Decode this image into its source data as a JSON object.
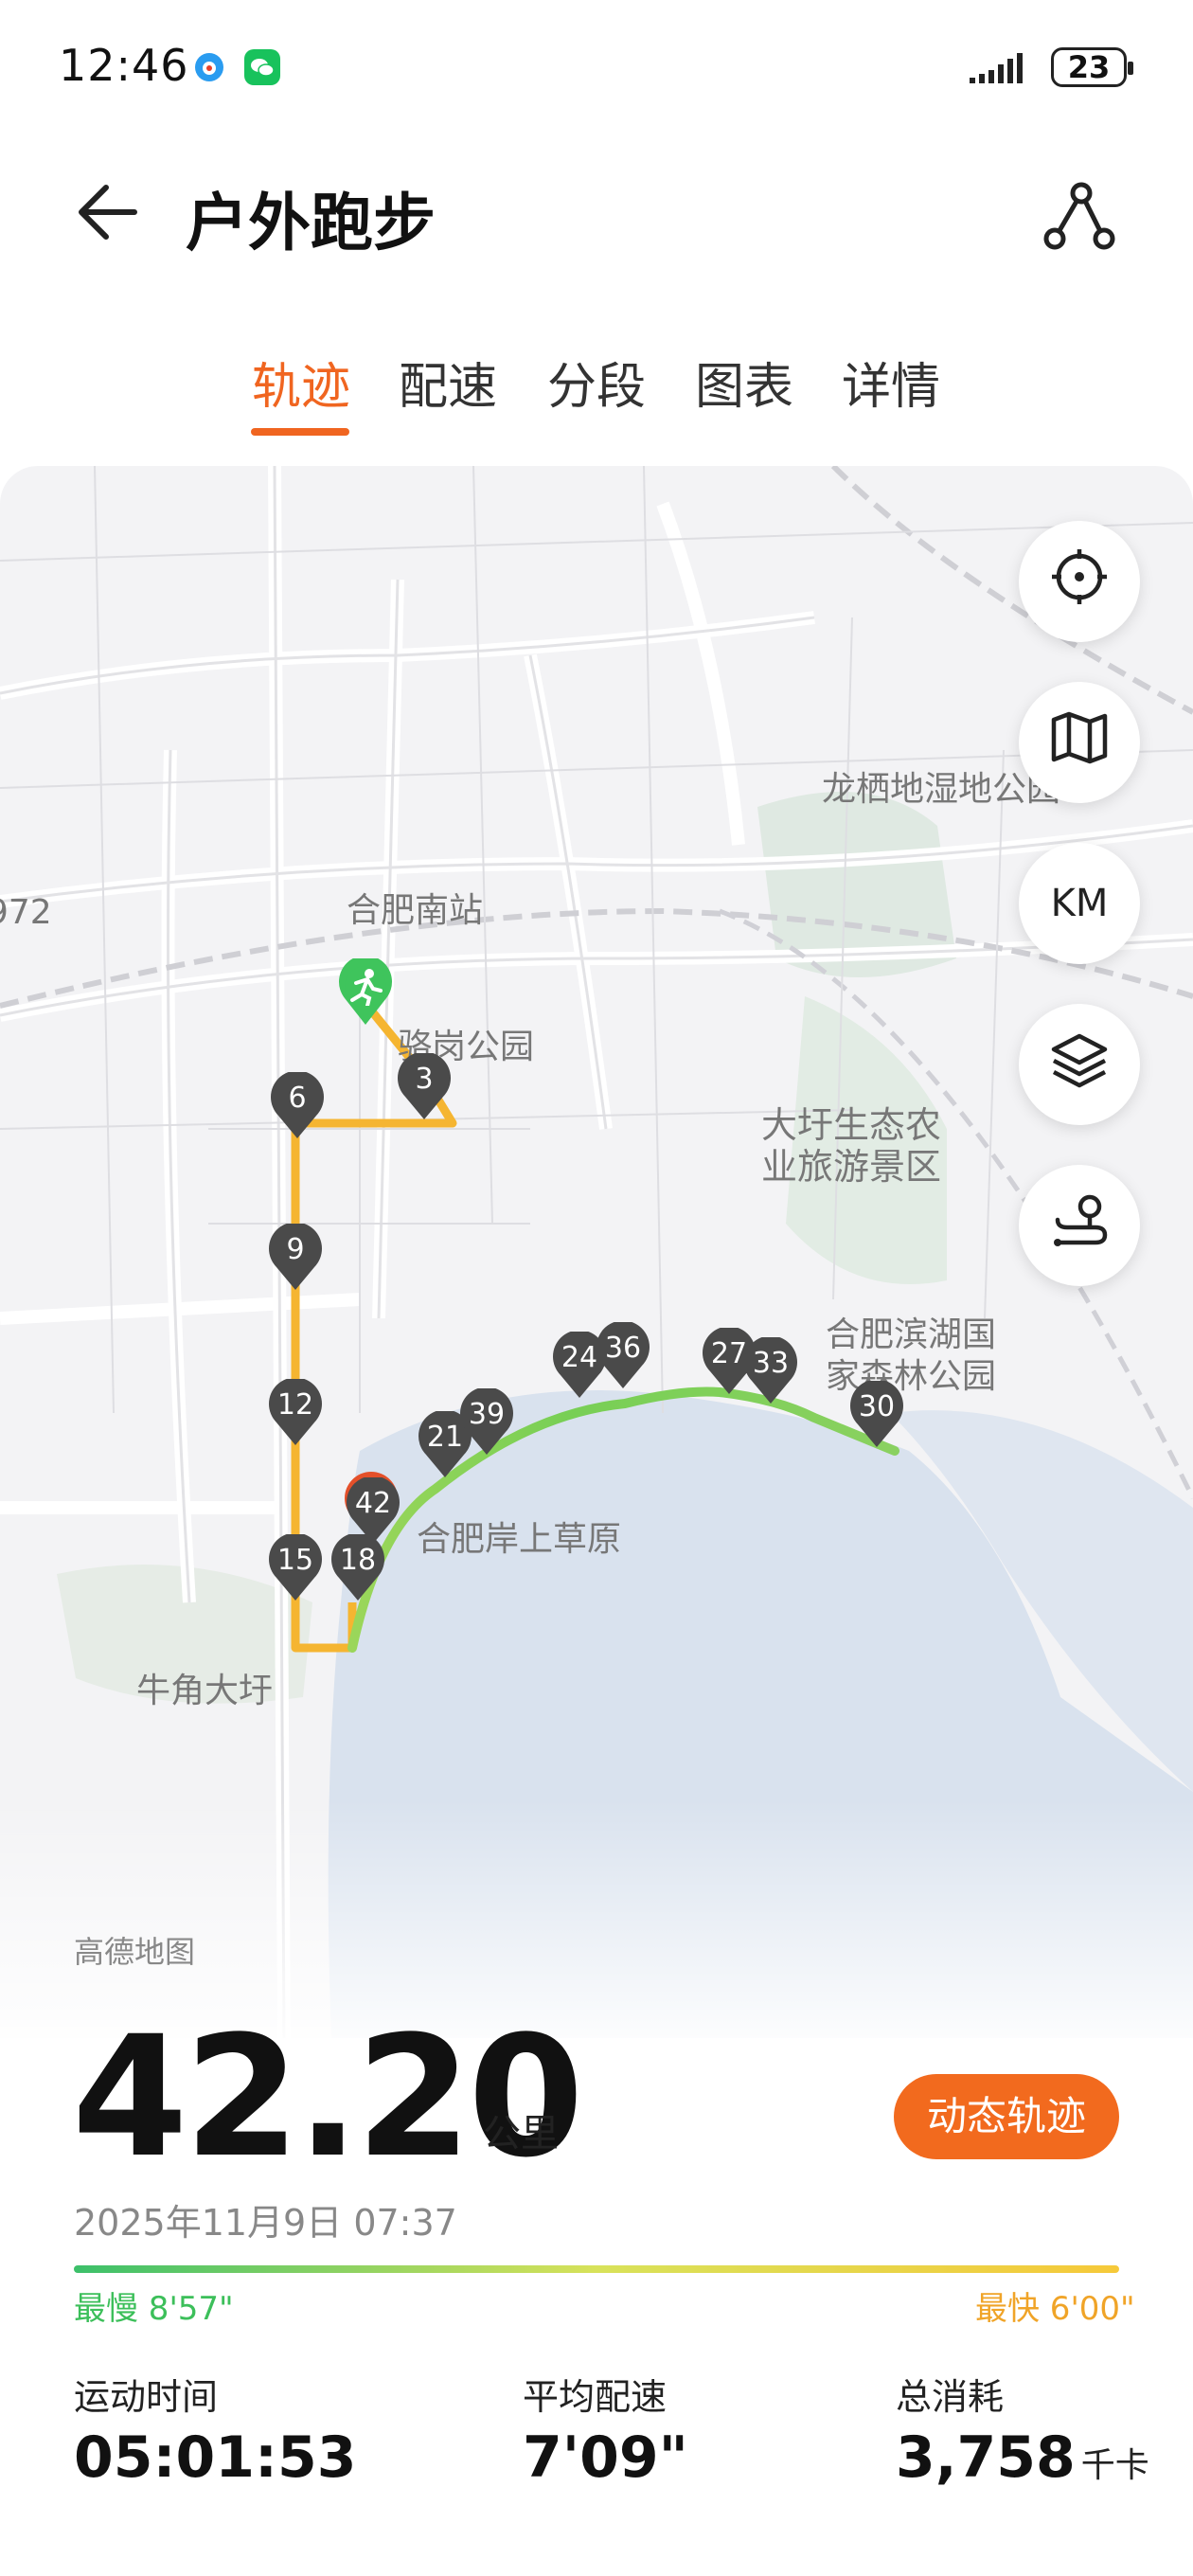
{
  "status_bar": {
    "time": "12:46",
    "battery": "23",
    "icons": [
      "weibo-icon",
      "wechat-icon",
      "signal-icon",
      "battery-icon"
    ]
  },
  "header": {
    "title": "户外跑步",
    "back_icon": "arrow-left-icon",
    "share_icon": "route-share-icon"
  },
  "tabs": [
    {
      "label": "轨迹",
      "active": true
    },
    {
      "label": "配速",
      "active": false
    },
    {
      "label": "分段",
      "active": false
    },
    {
      "label": "图表",
      "active": false
    },
    {
      "label": "详情",
      "active": false
    }
  ],
  "map": {
    "labels": {
      "longqi": "龙栖地湿地公园",
      "hefei_south": "合肥南站",
      "luogang": "骆岗公园",
      "dawei": "大圩生态农\n业旅游景区",
      "binhu": "合肥滨湖国\n家森林公园",
      "anshang": "合肥岸上草原",
      "niujiao": "牛角大圩",
      "left_edge": "972"
    },
    "controls": [
      {
        "name": "locate-button",
        "icon": "crosshair-icon"
      },
      {
        "name": "map-style-button",
        "icon": "map-icon"
      },
      {
        "name": "km-marker-button",
        "label": "KM"
      },
      {
        "name": "layers-button",
        "icon": "layers-icon"
      },
      {
        "name": "route-button",
        "icon": "route-pin-icon"
      }
    ],
    "km_markers": [
      "3",
      "6",
      "9",
      "12",
      "15",
      "18",
      "21",
      "24",
      "27",
      "30",
      "33",
      "36",
      "39",
      "42"
    ],
    "start_icon": "runner-icon"
  },
  "stats": {
    "map_source": "高德地图",
    "distance": "42.20",
    "distance_unit": "公里",
    "dynamic_track_label": "动态轨迹",
    "date": "2025年11月9日 07:37",
    "pace_slow_label": "最慢 8'57\"",
    "pace_fast_label": "最快 6'00\"",
    "duration_label": "运动时间",
    "duration_value": "05:01:53",
    "avg_pace_label": "平均配速",
    "avg_pace_value": "7'09\"",
    "calories_label": "总消耗",
    "calories_value": "3,758",
    "calories_unit": "千卡"
  },
  "colors": {
    "accent": "#f06520",
    "route_slow": "#3cc06a",
    "route_fast": "#f6b93a",
    "marker": "#4a4a4a"
  }
}
